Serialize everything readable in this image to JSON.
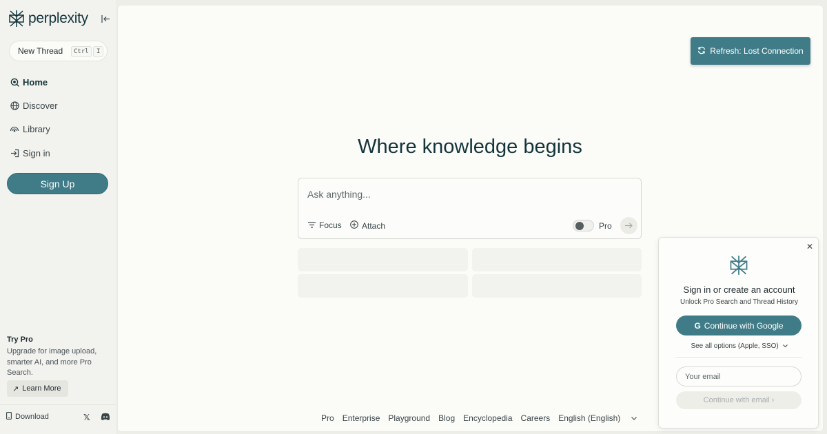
{
  "brand": {
    "name": "perplexity",
    "accent": "#3f7c88"
  },
  "sidebar": {
    "new_thread_label": "New Thread",
    "shortcut_key1": "Ctrl",
    "shortcut_key2": "I",
    "items": [
      {
        "label": "Home",
        "icon": "home-icon",
        "active": true
      },
      {
        "label": "Discover",
        "icon": "globe-icon"
      },
      {
        "label": "Library",
        "icon": "library-icon"
      },
      {
        "label": "Sign in",
        "icon": "sign-in-icon"
      }
    ],
    "signup_label": "Sign Up",
    "try_pro_title": "Try Pro",
    "try_pro_desc": "Upgrade for image upload, smarter AI, and more Pro Search.",
    "learn_more_label": "Learn More",
    "download_label": "Download"
  },
  "main": {
    "refresh_label": "Refresh: Lost Connection",
    "headline": "Where knowledge begins",
    "search_placeholder": "Ask anything...",
    "focus_label": "Focus",
    "attach_label": "Attach",
    "pro_label": "Pro"
  },
  "footer": {
    "links": [
      "Pro",
      "Enterprise",
      "Playground",
      "Blog",
      "Encyclopedia",
      "Careers"
    ],
    "language": "English (English)"
  },
  "auth_card": {
    "title": "Sign in or create an account",
    "subtitle": "Unlock Pro Search and Thread History",
    "google_label": "Continue with Google",
    "see_all_label": "See all options (Apple, SSO)",
    "email_placeholder": "Your email",
    "continue_email_label": "Continue with email"
  }
}
